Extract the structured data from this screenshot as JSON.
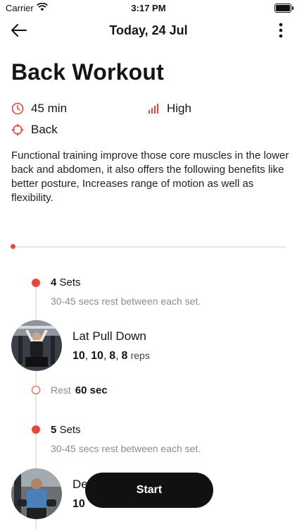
{
  "status_bar": {
    "carrier": "Carrier",
    "time": "3:17 PM"
  },
  "nav": {
    "title": "Today, 24 Jul",
    "back_icon": "arrow-left-icon",
    "more_icon": "more-vertical-icon"
  },
  "workout": {
    "title": "Back Workout",
    "duration": "45 min",
    "intensity": "High",
    "target": "Back",
    "description": "Functional training improve those core muscles in the lower back and abdomen, it also offers the following benefits like better posture, Increases range of motion as well as flexibility."
  },
  "blocks": [
    {
      "sets_count": "4",
      "sets_word": "Sets",
      "rest_info": "30-45 secs rest between each set.",
      "exercise": {
        "name": "Lat Pull Down",
        "reps": [
          "10",
          "10",
          "8",
          "8"
        ],
        "unit": "reps"
      },
      "rest_label": "Rest",
      "rest_value": "60 sec"
    },
    {
      "sets_count": "5",
      "sets_word": "Sets",
      "rest_info": "30-45 secs rest between each set.",
      "exercise": {
        "name": "De",
        "reps": [
          "10"
        ],
        "unit": ""
      }
    }
  ],
  "start_button": {
    "label": "Start"
  },
  "colors": {
    "accent": "#e5473b",
    "button": "#111111"
  }
}
